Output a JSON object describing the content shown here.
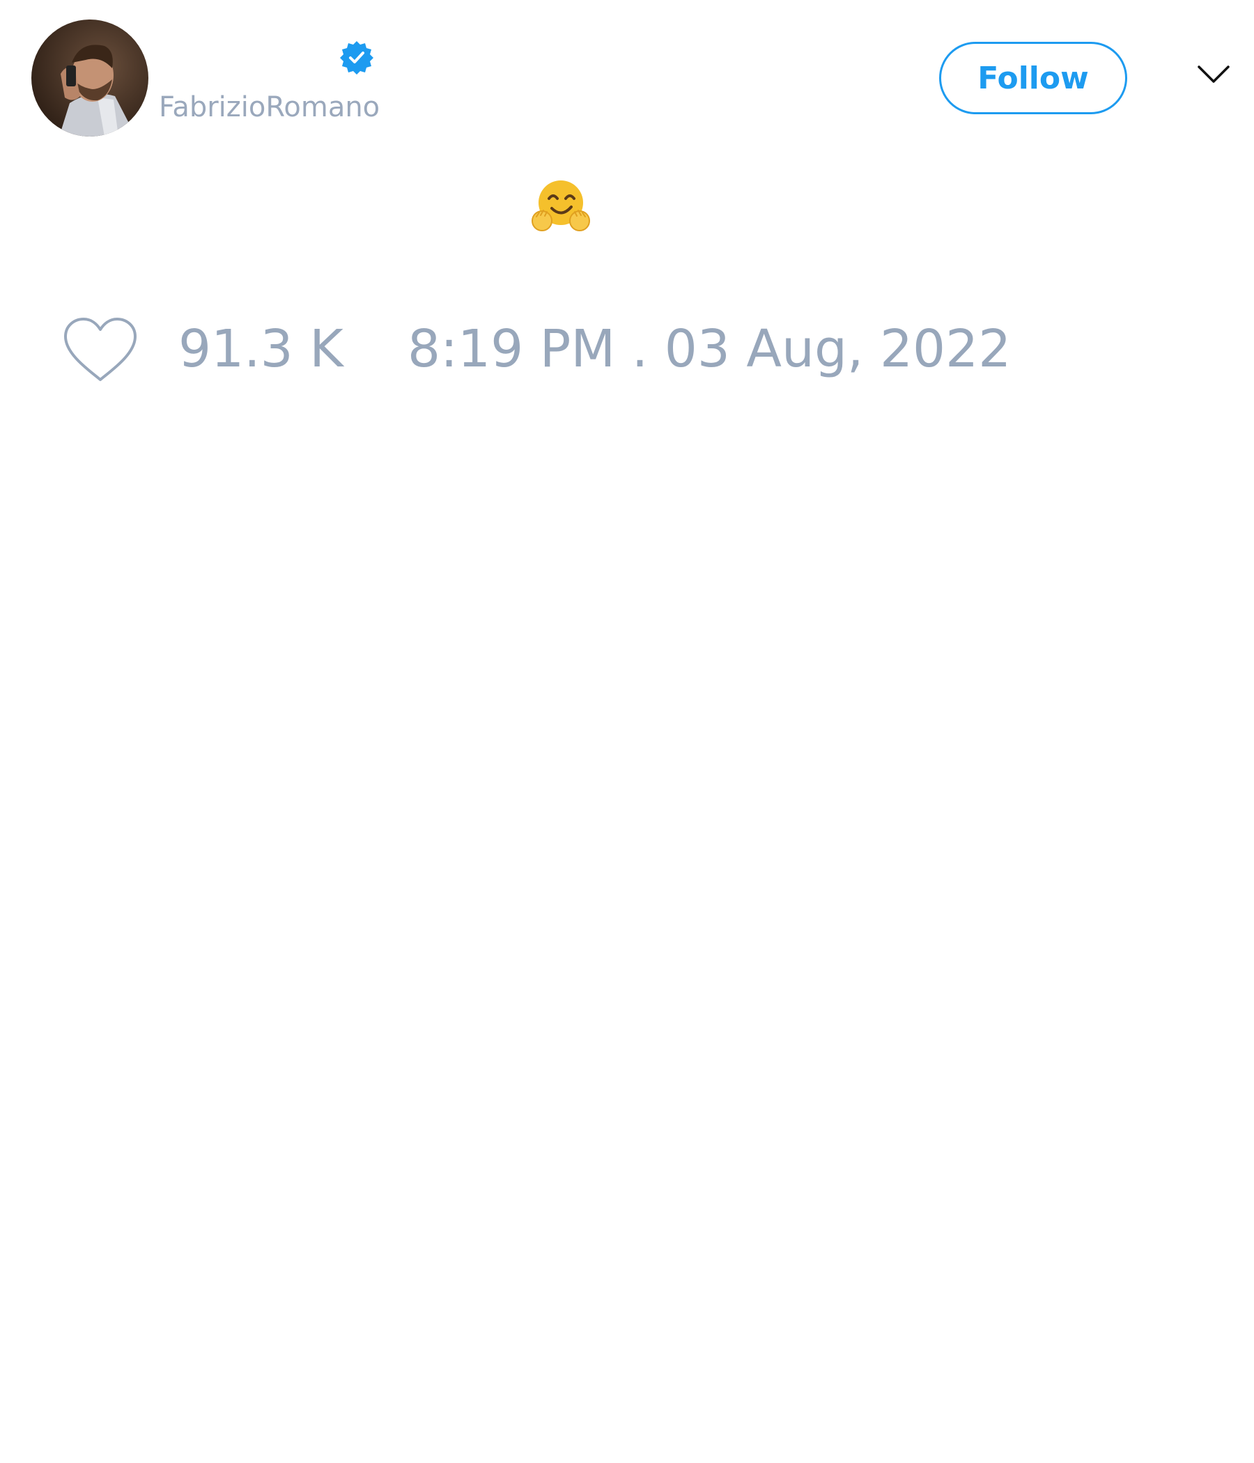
{
  "author": {
    "handle": "FabrizioRomano",
    "verified": true,
    "avatar_icon": "profile-photo"
  },
  "header": {
    "follow_label": "Follow",
    "menu_icon": "chevron-down-icon"
  },
  "tweet": {
    "text_emoji": "hugging-face-emoji"
  },
  "footer": {
    "like_icon": "heart-icon",
    "like_count": "91.3 K",
    "timestamp": "8:19 PM . 03 Aug, 2022"
  },
  "colors": {
    "accent": "#1d9bf0",
    "muted_text": "#98a7bb",
    "background": "#ffffff"
  }
}
